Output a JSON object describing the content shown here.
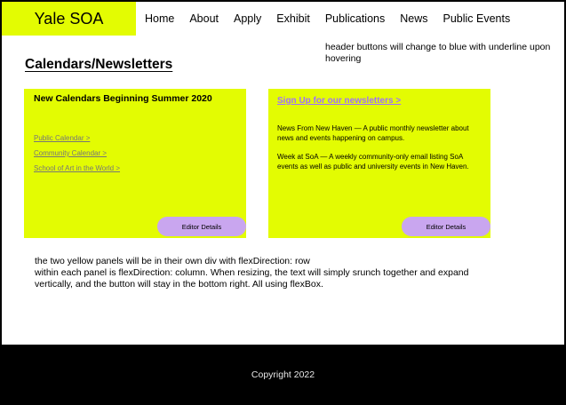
{
  "header": {
    "brand": "Yale SOA",
    "nav": [
      "Home",
      "About",
      "Apply",
      "Exhibit",
      "Publications",
      "News",
      "Public Events"
    ],
    "hover_note": "header buttons will change to blue with underline upon hovering"
  },
  "main": {
    "title": "Calendars/Newsletters",
    "left_panel": {
      "heading": "New Calendars Beginning Summer 2020",
      "links": [
        "Public Calendar >",
        "Community Calendar >",
        "School of Art in the World >"
      ],
      "button": "Editor Details"
    },
    "right_panel": {
      "signup": "Sign Up for our newsletters >",
      "paragraphs": [
        "News From New Haven — A public monthly newsletter about news and events happening on campus.",
        "Week at SoA — A weekly community-only email listing SoA events as well as public and university events in New Haven."
      ],
      "button": "Editor Details"
    },
    "explanation": [
      "the two yellow panels will be in their own div with flexDirection: row",
      "within each panel is flexDirection: column. When resizing, the text will simply srunch together and expand vertically, and the button will stay in the bottom right. All using flexBox."
    ]
  },
  "footer": {
    "copyright": "Copyright 2022"
  },
  "colors": {
    "accent_yellow": "#e3fc02",
    "button_purple": "#c9a6ef",
    "link_purple": "#a070ff",
    "footer_bg": "#000000"
  }
}
